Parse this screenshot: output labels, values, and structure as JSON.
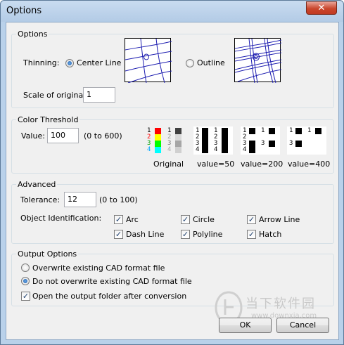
{
  "window": {
    "title": "Options",
    "close_glyph": "✕"
  },
  "options_group": {
    "title": "Options",
    "thinning_label": "Thinning:",
    "center_line_label": "Center Line",
    "outline_label": "Outline",
    "scale_label": "Scale of original:",
    "scale_value": "1"
  },
  "color_threshold": {
    "title": "Color Threshold",
    "value_label": "Value:",
    "value": "100",
    "range_hint": "(0 to 600)",
    "row_numbers": [
      "1",
      "2",
      "3",
      "4"
    ],
    "swatch_colors": [
      "#ff0000",
      "#ffff00",
      "#00ff00",
      "#00ffff"
    ],
    "gray_colors": [
      "#404040",
      "#d9d9d9",
      "#a6a6a6",
      "#d0d0d0"
    ],
    "captions": [
      "Original",
      "value=50",
      "value=200",
      "value=400"
    ]
  },
  "advanced": {
    "title": "Advanced",
    "tolerance_label": "Tolerance:",
    "tolerance_value": "12",
    "tolerance_hint": "(0 to 100)",
    "object_id_label": "Object Identification:",
    "checks": [
      {
        "label": "Arc",
        "checked": true
      },
      {
        "label": "Circle",
        "checked": true
      },
      {
        "label": "Arrow Line",
        "checked": true
      },
      {
        "label": "Dash Line",
        "checked": true
      },
      {
        "label": "Polyline",
        "checked": true
      },
      {
        "label": "Hatch",
        "checked": true
      }
    ]
  },
  "output_options": {
    "title": "Output Options",
    "overwrite_label": "Overwrite existing CAD format file",
    "no_overwrite_label": "Do not overwrite existing CAD format file",
    "open_folder_label": "Open the output folder after conversion"
  },
  "buttons": {
    "ok": "OK",
    "cancel": "Cancel"
  },
  "watermark": {
    "text": "当下软件园",
    "url": "www.downxia.com"
  },
  "colors": {
    "line_blue": "#1c1cb0",
    "radio_dot": "#1b5aa8"
  }
}
